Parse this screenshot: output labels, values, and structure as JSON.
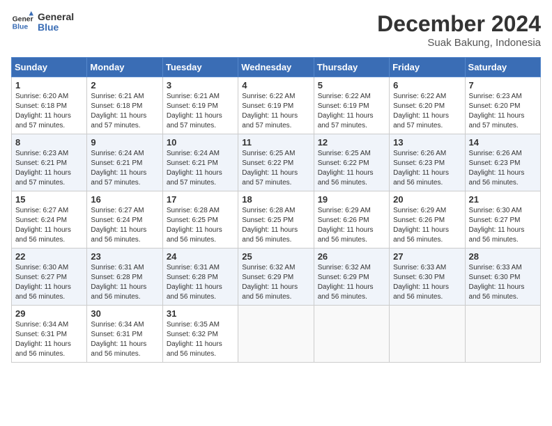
{
  "header": {
    "logo_line1": "General",
    "logo_line2": "Blue",
    "month": "December 2024",
    "location": "Suak Bakung, Indonesia"
  },
  "weekdays": [
    "Sunday",
    "Monday",
    "Tuesday",
    "Wednesday",
    "Thursday",
    "Friday",
    "Saturday"
  ],
  "weeks": [
    [
      {
        "day": "1",
        "sunrise": "6:20 AM",
        "sunset": "6:18 PM",
        "daylight": "11 hours and 57 minutes."
      },
      {
        "day": "2",
        "sunrise": "6:21 AM",
        "sunset": "6:18 PM",
        "daylight": "11 hours and 57 minutes."
      },
      {
        "day": "3",
        "sunrise": "6:21 AM",
        "sunset": "6:19 PM",
        "daylight": "11 hours and 57 minutes."
      },
      {
        "day": "4",
        "sunrise": "6:22 AM",
        "sunset": "6:19 PM",
        "daylight": "11 hours and 57 minutes."
      },
      {
        "day": "5",
        "sunrise": "6:22 AM",
        "sunset": "6:19 PM",
        "daylight": "11 hours and 57 minutes."
      },
      {
        "day": "6",
        "sunrise": "6:22 AM",
        "sunset": "6:20 PM",
        "daylight": "11 hours and 57 minutes."
      },
      {
        "day": "7",
        "sunrise": "6:23 AM",
        "sunset": "6:20 PM",
        "daylight": "11 hours and 57 minutes."
      }
    ],
    [
      {
        "day": "8",
        "sunrise": "6:23 AM",
        "sunset": "6:21 PM",
        "daylight": "11 hours and 57 minutes."
      },
      {
        "day": "9",
        "sunrise": "6:24 AM",
        "sunset": "6:21 PM",
        "daylight": "11 hours and 57 minutes."
      },
      {
        "day": "10",
        "sunrise": "6:24 AM",
        "sunset": "6:21 PM",
        "daylight": "11 hours and 57 minutes."
      },
      {
        "day": "11",
        "sunrise": "6:25 AM",
        "sunset": "6:22 PM",
        "daylight": "11 hours and 57 minutes."
      },
      {
        "day": "12",
        "sunrise": "6:25 AM",
        "sunset": "6:22 PM",
        "daylight": "11 hours and 56 minutes."
      },
      {
        "day": "13",
        "sunrise": "6:26 AM",
        "sunset": "6:23 PM",
        "daylight": "11 hours and 56 minutes."
      },
      {
        "day": "14",
        "sunrise": "6:26 AM",
        "sunset": "6:23 PM",
        "daylight": "11 hours and 56 minutes."
      }
    ],
    [
      {
        "day": "15",
        "sunrise": "6:27 AM",
        "sunset": "6:24 PM",
        "daylight": "11 hours and 56 minutes."
      },
      {
        "day": "16",
        "sunrise": "6:27 AM",
        "sunset": "6:24 PM",
        "daylight": "11 hours and 56 minutes."
      },
      {
        "day": "17",
        "sunrise": "6:28 AM",
        "sunset": "6:25 PM",
        "daylight": "11 hours and 56 minutes."
      },
      {
        "day": "18",
        "sunrise": "6:28 AM",
        "sunset": "6:25 PM",
        "daylight": "11 hours and 56 minutes."
      },
      {
        "day": "19",
        "sunrise": "6:29 AM",
        "sunset": "6:26 PM",
        "daylight": "11 hours and 56 minutes."
      },
      {
        "day": "20",
        "sunrise": "6:29 AM",
        "sunset": "6:26 PM",
        "daylight": "11 hours and 56 minutes."
      },
      {
        "day": "21",
        "sunrise": "6:30 AM",
        "sunset": "6:27 PM",
        "daylight": "11 hours and 56 minutes."
      }
    ],
    [
      {
        "day": "22",
        "sunrise": "6:30 AM",
        "sunset": "6:27 PM",
        "daylight": "11 hours and 56 minutes."
      },
      {
        "day": "23",
        "sunrise": "6:31 AM",
        "sunset": "6:28 PM",
        "daylight": "11 hours and 56 minutes."
      },
      {
        "day": "24",
        "sunrise": "6:31 AM",
        "sunset": "6:28 PM",
        "daylight": "11 hours and 56 minutes."
      },
      {
        "day": "25",
        "sunrise": "6:32 AM",
        "sunset": "6:29 PM",
        "daylight": "11 hours and 56 minutes."
      },
      {
        "day": "26",
        "sunrise": "6:32 AM",
        "sunset": "6:29 PM",
        "daylight": "11 hours and 56 minutes."
      },
      {
        "day": "27",
        "sunrise": "6:33 AM",
        "sunset": "6:30 PM",
        "daylight": "11 hours and 56 minutes."
      },
      {
        "day": "28",
        "sunrise": "6:33 AM",
        "sunset": "6:30 PM",
        "daylight": "11 hours and 56 minutes."
      }
    ],
    [
      {
        "day": "29",
        "sunrise": "6:34 AM",
        "sunset": "6:31 PM",
        "daylight": "11 hours and 56 minutes."
      },
      {
        "day": "30",
        "sunrise": "6:34 AM",
        "sunset": "6:31 PM",
        "daylight": "11 hours and 56 minutes."
      },
      {
        "day": "31",
        "sunrise": "6:35 AM",
        "sunset": "6:32 PM",
        "daylight": "11 hours and 56 minutes."
      },
      null,
      null,
      null,
      null
    ]
  ]
}
